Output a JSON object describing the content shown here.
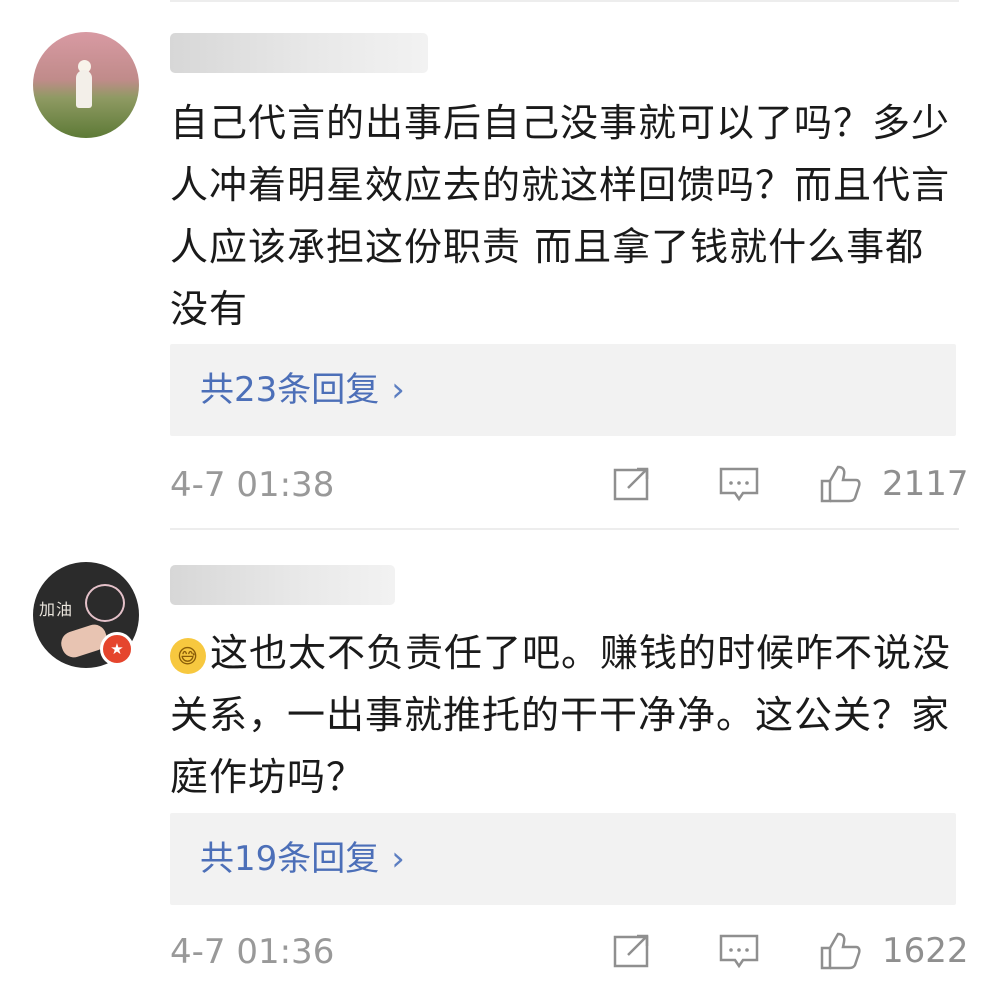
{
  "comments": [
    {
      "text": "自己代言的出事后自己没事就可以了吗？多少人冲着明星效应去的就这样回馈吗？而且代言人应该承担这份职责 而且拿了钱就什么事都没有",
      "reply_count": "共23条回复",
      "timestamp": "4-7 01:38",
      "likes": "2117",
      "avatar_icon": "landscape-avatar-icon"
    },
    {
      "emoji": "😅",
      "text": "这也太不负责任了吧。赚钱的时候咋不说没关系，一出事就推托的干干净净。这公关？家庭作坊吗？",
      "reply_count": "共19条回复",
      "timestamp": "4-7 01:36",
      "likes": "1622",
      "avatar_icon": "chalkboard-avatar-icon",
      "avatar_text": "加油"
    }
  ],
  "ui": {
    "chevron": "›",
    "badge_icon": "star-badge-icon"
  },
  "colors": {
    "link_blue": "#4c6fb8",
    "meta_gray": "#999999",
    "reply_bg": "#f2f2f2"
  }
}
